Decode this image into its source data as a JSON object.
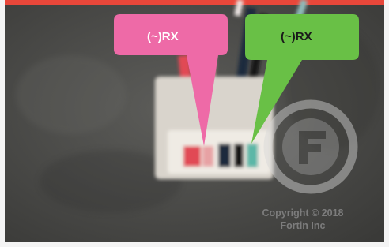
{
  "photo": {
    "colors": {
      "background_dark": "#3a3a38",
      "background_light": "#5d5d5a",
      "border_white": "#f4f4f4",
      "top_bar_red": "#e8473a",
      "connector_white": "#d9d4cc",
      "wire_red": "#e14a55",
      "wire_pink": "#e7a2a4",
      "wire_dark_blue": "#1f2a3d",
      "wire_black": "#151719",
      "wire_teal": "#5cb7a7"
    }
  },
  "callouts": [
    {
      "text_prefix": "(~)",
      "text_main": "RX",
      "color": "#ee6aa7",
      "text_color": "#ffffff"
    },
    {
      "text_prefix": "(~)",
      "text_main": "RX",
      "color": "#69c046",
      "text_color": "#1a1a1a"
    }
  ],
  "watermark": {
    "logo_icon": "fortin-f-logo-icon",
    "line1": "Copyright © 2018",
    "line2": "Fortin Inc"
  }
}
